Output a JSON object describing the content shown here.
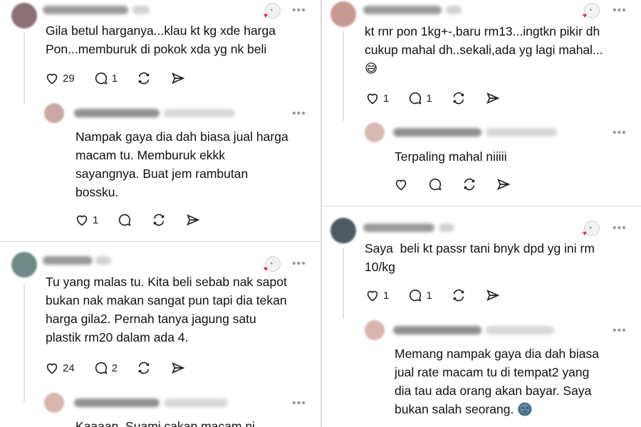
{
  "left": {
    "post1": {
      "text": "Gila betul harganya...klau kt kg xde harga\nPon...memburuk di pokok xda yg nk beli",
      "likes": "29",
      "replies": "1"
    },
    "reply1": {
      "text": "Nampak gaya dia dah biasa jual harga\nmacam tu. Memburuk ekkk\nsayangnya. Buat jem rambutan\nbossku.",
      "likes": "1",
      "replies": ""
    },
    "post2": {
      "text": "Tu yang malas tu. Kita beli sebab nak sapot\nbukan nak makan sangat pun tapi dia tekan\nharga gila2. Pernah tanya jagung satu\nplastik rm20 dalam ada 4.",
      "likes": "24",
      "replies": "2"
    },
    "reply2_partial": "Kaaaan. Suami cakap macam ni"
  },
  "right": {
    "post1": {
      "text": "kt rnr pon 1kg+-,baru rm13...ingtkn pikir dh\ncukup mahal dh..sekali,ada yg lagi mahal...\n😅",
      "likes": "1",
      "replies": "1"
    },
    "reply1": {
      "text": "Terpaling mahal niiiii"
    },
    "post2": {
      "text": "Saya  beli kt passr tani bnyk dpd yg ini rm\n10/kg",
      "likes": "1",
      "replies": "1"
    },
    "reply2": {
      "text": "Memang nampak gaya dia dah biasa\njual rate macam tu di tempat2 yang\ndia tau ada orang akan bayar. Saya\nbukan salah seorang. 🌚"
    }
  },
  "icons": {
    "like": "heart-icon",
    "reply": "comment-icon",
    "repost": "repost-icon",
    "share": "send-icon",
    "more": "more-icon"
  },
  "ui": {
    "more_glyph": "•••"
  }
}
